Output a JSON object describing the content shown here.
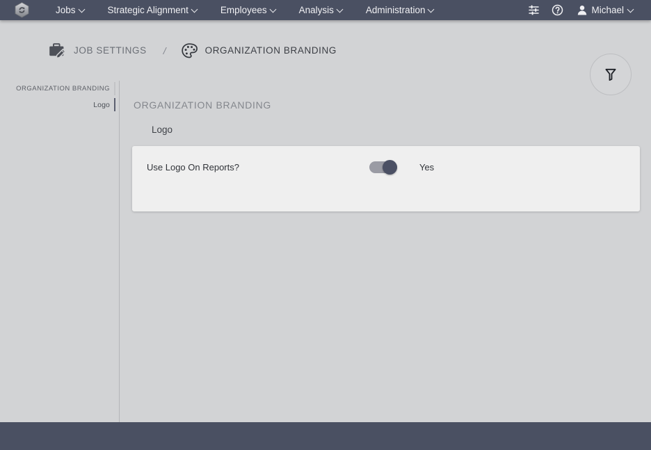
{
  "navbar": {
    "logo_icon": "hexagon-logo-icon",
    "menu": [
      {
        "label": "Jobs",
        "icon": "chevron-down-icon"
      },
      {
        "label": "Strategic Alignment",
        "icon": "chevron-down-icon"
      },
      {
        "label": "Employees",
        "icon": "chevron-down-icon"
      },
      {
        "label": "Analysis",
        "icon": "chevron-down-icon"
      },
      {
        "label": "Administration",
        "icon": "chevron-down-icon"
      }
    ],
    "settings_icon": "sliders-icon",
    "help_icon": "help-circle-icon",
    "user": {
      "avatar_icon": "user-avatar-icon",
      "name": "Michael",
      "caret_icon": "chevron-down-icon"
    },
    "background_color": "#4a5062"
  },
  "breadcrumb": {
    "items": [
      {
        "label": "JOB SETTINGS",
        "icon": "briefcase-edit-icon"
      },
      {
        "label": "ORGANIZATION BRANDING",
        "icon": "palette-icon"
      }
    ],
    "separator": "/"
  },
  "filter_button": {
    "icon": "filter-funnel-icon",
    "label": ""
  },
  "sidebar": {
    "items": [
      {
        "label": "ORGANIZATION BRANDING",
        "active": false
      },
      {
        "label": "Logo",
        "active": true
      }
    ]
  },
  "main": {
    "section_title": "ORGANIZATION BRANDING",
    "group_title": "Logo",
    "settings": [
      {
        "label": "Use Logo On Reports?",
        "control": "toggle",
        "state": "on",
        "value": "Yes"
      }
    ]
  },
  "colors": {
    "page_background": "#d2d3d5",
    "navbar": "#4a5062",
    "footer": "#4a5062",
    "card": "#efefef",
    "toggle_track": "#9a9ba4",
    "toggle_knob": "#4b5064"
  }
}
